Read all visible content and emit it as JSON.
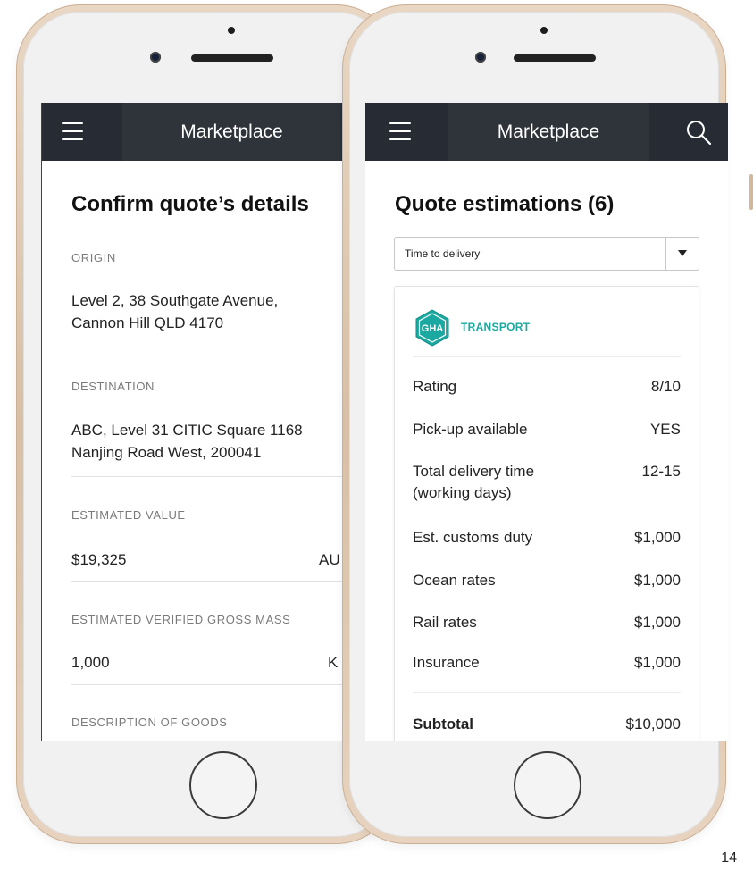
{
  "left_screen": {
    "nav_title": "Marketplace",
    "title": "Confirm quote’s details",
    "origin": {
      "label": "ORIGIN",
      "line1": "Level 2, 38 Southgate Avenue,",
      "line2": "Cannon Hill QLD 4170"
    },
    "destination": {
      "label": "DESTINATION",
      "line1": "ABC, Level 31 CITIC Square 1168",
      "line2": "Nanjing Road West, 200041"
    },
    "estimated_value": {
      "label": "ESTIMATED VALUE",
      "value": "$19,325",
      "unit": "AU"
    },
    "gross_mass": {
      "label": "ESTIMATED VERIFIED GROSS MASS",
      "value": "1,000",
      "unit": "K"
    },
    "description": {
      "label": "DESCRIPTION OF GOODS"
    }
  },
  "right_screen": {
    "nav_title": "Marketplace",
    "title": "Quote estimations (6)",
    "sort": {
      "selected": "Time to delivery"
    },
    "card": {
      "logo_text": "GHA",
      "brand": "TRANSPORT",
      "rows": [
        {
          "label": "Rating",
          "value": "8/10"
        },
        {
          "label": "Pick-up available",
          "value": "YES"
        },
        {
          "label": "Total delivery time",
          "label2": "(working days)",
          "value": "12-15"
        },
        {
          "label": "Est. customs duty",
          "value": "$1,000"
        },
        {
          "label": "Ocean rates",
          "value": "$1,000"
        },
        {
          "label": "Rail rates",
          "value": "$1,000"
        },
        {
          "label": "Insurance",
          "value": "$1,000"
        }
      ],
      "subtotal": {
        "label": "Subtotal",
        "value": "$10,000"
      }
    }
  },
  "page_number": "14",
  "colors": {
    "navbar": "#262b34",
    "brand": "#1aa8a0"
  }
}
